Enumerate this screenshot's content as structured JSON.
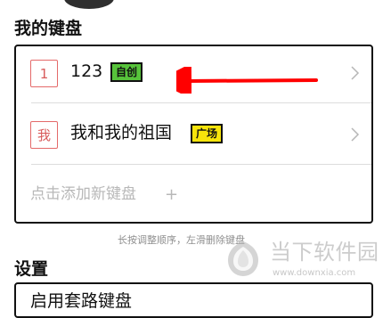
{
  "sections": {
    "my_keyboards_title": "我的键盘",
    "settings_title": "设置"
  },
  "keyboards": [
    {
      "index": "1",
      "name": "123",
      "tag": "自创",
      "tag_color": "#57c33b"
    },
    {
      "index": "我",
      "name": "我和我的祖国",
      "tag": "广场",
      "tag_color": "#f7e40b"
    }
  ],
  "add_keyboard": {
    "label": "点击添加新键盘",
    "icon": "+"
  },
  "hint": "长按调整顺序，左滑删除键盘",
  "settings": {
    "first_item": "启用套路键盘"
  },
  "watermark": {
    "title": "当下软件园",
    "url": "www.downxia.com"
  },
  "colors": {
    "accent_red": "#e34a4a",
    "arrow_red": "#ff0000",
    "border": "#111111"
  }
}
